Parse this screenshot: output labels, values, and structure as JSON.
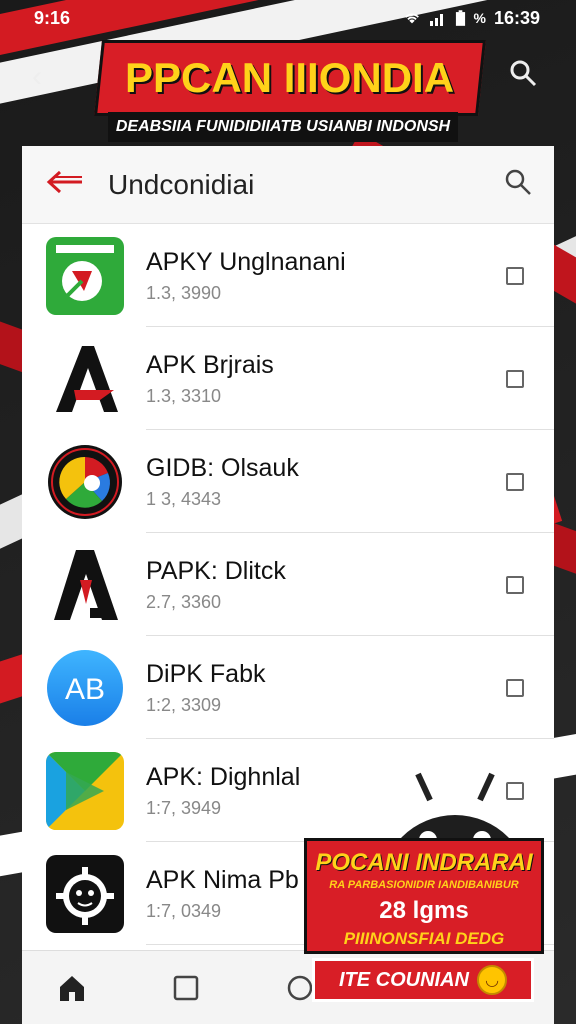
{
  "status_bar": {
    "time": "9:16",
    "battery_percent": "%",
    "clock_right": "16:39"
  },
  "banner": {
    "title": "PPCAN IIIONDIA",
    "subtitle": "DEABSIIA FUNIDIDIIATB USIANBI INDONSH"
  },
  "header": {
    "title": "Undconidiai"
  },
  "apps": [
    {
      "name": "APKY Unglnanani",
      "version": "1.3, 3990",
      "icon": "green-shield-icon",
      "checked": false
    },
    {
      "name": "APK Brjrais",
      "version": "1.3, 3310",
      "icon": "a-logo-icon",
      "checked": false
    },
    {
      "name": "GIDB: Olsauk",
      "version": "1 3, 4343",
      "icon": "colorful-circle-icon",
      "checked": false
    },
    {
      "name": "PAPK: Dlitck",
      "version": "2.7, 3360",
      "icon": "a-red-logo-icon",
      "checked": false
    },
    {
      "name": "DiPK Fabk",
      "version": "1:2, 3309",
      "icon": "ab-blue-icon",
      "checked": false
    },
    {
      "name": "APK: Dighnlal",
      "version": "1:7, 3949",
      "icon": "play-store-icon",
      "checked": false
    },
    {
      "name": "APK Nima Pb",
      "version": "1:7, 0349",
      "icon": "gear-face-icon",
      "checked": false
    }
  ],
  "promo": {
    "line1": "POCANI INDRARAI",
    "line2": "RA PARBASIONIDIR IANDIBANIBUR",
    "line3": "28 lgms",
    "line4": "PIIINONSFIAI DEDG",
    "button": "ITE COUNIAN"
  },
  "colors": {
    "accent_red": "#d31b22",
    "banner_yellow": "#ffd21a"
  }
}
